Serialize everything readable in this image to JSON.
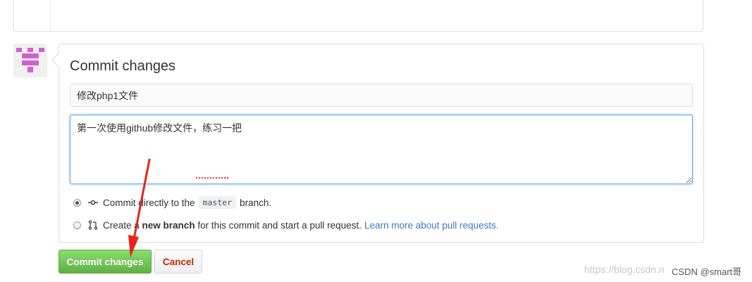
{
  "commit_form": {
    "heading": "Commit changes",
    "summary_value": "修改php1文件",
    "description_value": "第一次使用github修改文件，练习一把"
  },
  "options": {
    "direct": {
      "prefix": "Commit directly to the",
      "branch_name": "master",
      "suffix": "branch.",
      "checked": true
    },
    "new_branch": {
      "prefix": "Create a",
      "bold": "new branch",
      "suffix": "for this commit and start a pull request.",
      "link": "Learn more about pull requests.",
      "checked": false
    }
  },
  "buttons": {
    "commit_label": "Commit changes",
    "cancel_label": "Cancel"
  },
  "watermark": {
    "url": "https://blog.csdn.n",
    "tag": "CSDN @smart哥"
  },
  "colors": {
    "commit_button": "#60b044",
    "cancel_text": "#bd2c00",
    "link": "#4078c0",
    "focus_border": "#51a7e8",
    "annotation_arrow": "#e8231a",
    "avatar": "#d35fd0"
  },
  "icons": {
    "avatar": "identicon",
    "direct_commit": "git-commit-icon",
    "new_branch": "git-pull-request-icon"
  }
}
